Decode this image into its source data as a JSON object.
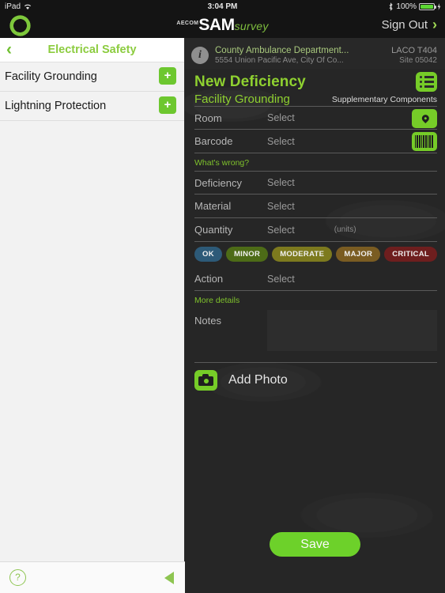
{
  "status_bar": {
    "device": "iPad",
    "wifi_icon": "wifi-icon",
    "time": "3:04 PM",
    "bluetooth_icon": "bluetooth-icon",
    "battery_percent": "100%",
    "charging_icon": "charging-bolt-icon"
  },
  "app_bar": {
    "logo_icon": "sync-circle-logo",
    "brand_prefix": "AECOM",
    "brand_name": "SAM",
    "brand_suffix": "survey",
    "sign_out_label": "Sign Out",
    "sign_out_chevron": "chevron-right-icon"
  },
  "sidebar": {
    "back_icon": "chevron-left-icon",
    "title": "Electrical Safety",
    "items": [
      {
        "label": "Facility Grounding",
        "add_label": "+"
      },
      {
        "label": "Lightning Protection",
        "add_label": "+"
      }
    ],
    "footer": {
      "help_label": "?",
      "back_triangle_icon": "triangle-left-icon"
    }
  },
  "site_info": {
    "info_icon": "info-icon",
    "name": "County Ambulance Department...",
    "address": "5554 Union Pacific Ave, City Of Co...",
    "code": "LACO T404",
    "site_number": "Site 05042"
  },
  "form": {
    "title": "New Deficiency",
    "subtitle": "Facility Grounding",
    "supplementary_label": "Supplementary Components",
    "list_icon": "list-icon",
    "rows_top": [
      {
        "key": "Room",
        "value": "Select",
        "button_icon": "map-pin-icon"
      },
      {
        "key": "Barcode",
        "value": "Select",
        "button_icon": "barcode-icon"
      }
    ],
    "whats_wrong_label": "What's wrong?",
    "rows_mid": [
      {
        "key": "Deficiency",
        "value": "Select",
        "units": ""
      },
      {
        "key": "Material",
        "value": "Select",
        "units": ""
      },
      {
        "key": "Quantity",
        "value": "Select",
        "units": "(units)"
      }
    ],
    "severity": [
      {
        "label": "OK",
        "color": "#2d5a78"
      },
      {
        "label": "MINOR",
        "color": "#4d6b17"
      },
      {
        "label": "MODERATE",
        "color": "#7d7a1e"
      },
      {
        "label": "MAJOR",
        "color": "#7a5c22"
      },
      {
        "label": "CRITICAL",
        "color": "#6e1e1e"
      }
    ],
    "rows_action": [
      {
        "key": "Action",
        "value": "Select",
        "units": ""
      }
    ],
    "more_details_label": "More details",
    "notes_key": "Notes",
    "notes_value": "",
    "add_photo_label": "Add Photo",
    "camera_icon": "camera-icon",
    "save_label": "Save"
  },
  "colors": {
    "accent_green": "#8fd130",
    "button_green": "#76cc28",
    "save_green": "#6dd12a",
    "panel_bg": "#262626",
    "sidebar_bg": "#f2f2f2"
  }
}
